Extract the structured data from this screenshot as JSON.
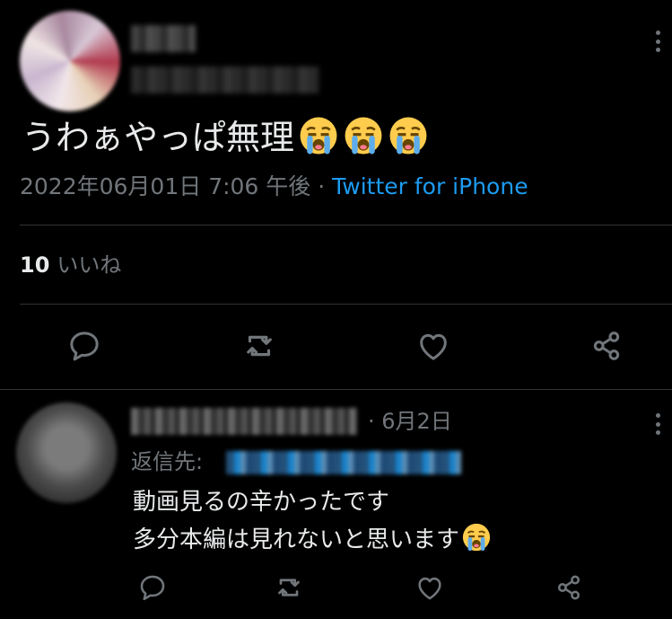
{
  "tweet": {
    "text": "うわぁやっぱ無理",
    "emoji": "loudly-crying-face",
    "emoji_count": 3,
    "timestamp": "2022年06月01日 7:06 午後",
    "separator": " · ",
    "source": "Twitter for iPhone",
    "like_count": "10",
    "like_label": "いいね"
  },
  "reply": {
    "date_sep": "·",
    "date": "6月2日",
    "reply_to_label": "返信先:",
    "line1": "動画見るの辛かったです",
    "line2": "多分本編は見れないと思います",
    "emoji": "loudly-crying-face"
  },
  "actions": [
    "reply-icon",
    "retweet-icon",
    "like-icon",
    "share-icon"
  ],
  "colors": {
    "background": "#000000",
    "text": "#e7e9ea",
    "secondary": "#71767b",
    "accent": "#1d9bf0",
    "divider": "#2f3336"
  }
}
